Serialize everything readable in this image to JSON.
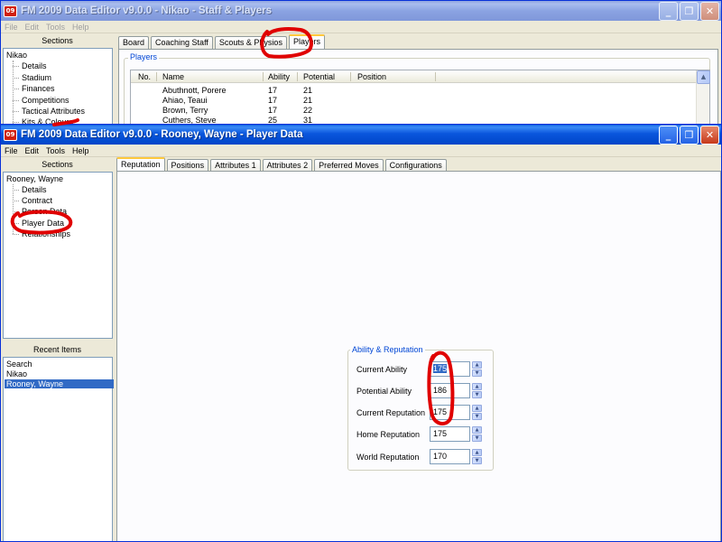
{
  "back_window": {
    "title": "FM 2009 Data Editor v9.0.0 - Nikao - Staff & Players",
    "icon_text": "09",
    "menu": [
      "File",
      "Edit",
      "Tools",
      "Help"
    ],
    "sections_header": "Sections",
    "tree_root": "Nikao",
    "tree_items": [
      "Details",
      "Stadium",
      "Finances",
      "Competitions",
      "Tactical Attributes",
      "Kits & Colours"
    ],
    "tabs": [
      "Board",
      "Coaching Staff",
      "Scouts & Physios",
      "Players"
    ],
    "active_tab": "Players",
    "group_title": "Players",
    "columns": [
      "No.",
      "Name",
      "Ability",
      "Potential",
      "Position"
    ],
    "rows": [
      {
        "no": "",
        "name": "Abuthnott, Porere",
        "ability": "17",
        "potential": "21",
        "position": ""
      },
      {
        "no": "",
        "name": "Ahiao, Teaui",
        "ability": "17",
        "potential": "21",
        "position": ""
      },
      {
        "no": "",
        "name": "Brown, Terry",
        "ability": "17",
        "potential": "22",
        "position": ""
      },
      {
        "no": "",
        "name": "Cuthers, Steve",
        "ability": "25",
        "potential": "31",
        "position": ""
      }
    ]
  },
  "front_window": {
    "title": "FM 2009 Data Editor v9.0.0 - Rooney, Wayne - Player Data",
    "icon_text": "09",
    "menu": [
      "File",
      "Edit",
      "Tools",
      "Help"
    ],
    "sections_header": "Sections",
    "tree_root": "Rooney, Wayne",
    "tree_items": [
      "Details",
      "Contract",
      "Person Data",
      "Player Data",
      "Relationships"
    ],
    "recent_header": "Recent Items",
    "recent_items": [
      "Search",
      "Nikao",
      "Rooney, Wayne"
    ],
    "selected_recent": "Rooney, Wayne",
    "tabs": [
      "Reputation",
      "Positions",
      "Attributes 1",
      "Attributes 2",
      "Preferred Moves",
      "Configurations"
    ],
    "active_tab": "Reputation",
    "group_title": "Ability & Reputation",
    "fields": [
      {
        "label": "Current Ability",
        "value": "175"
      },
      {
        "label": "Potential Ability",
        "value": "186"
      },
      {
        "label": "Current Reputation",
        "value": "175"
      },
      {
        "label": "Home Reputation",
        "value": "175"
      },
      {
        "label": "World Reputation",
        "value": "170"
      }
    ]
  },
  "colors": {
    "annotation": "#e00000",
    "selection": "#316ac5",
    "title_active": "#0a56dd",
    "title_inactive": "#8ba3e2"
  },
  "icons": [
    "minimize-icon",
    "maximize-icon",
    "close-icon",
    "spin-up-icon",
    "spin-down-icon"
  ]
}
